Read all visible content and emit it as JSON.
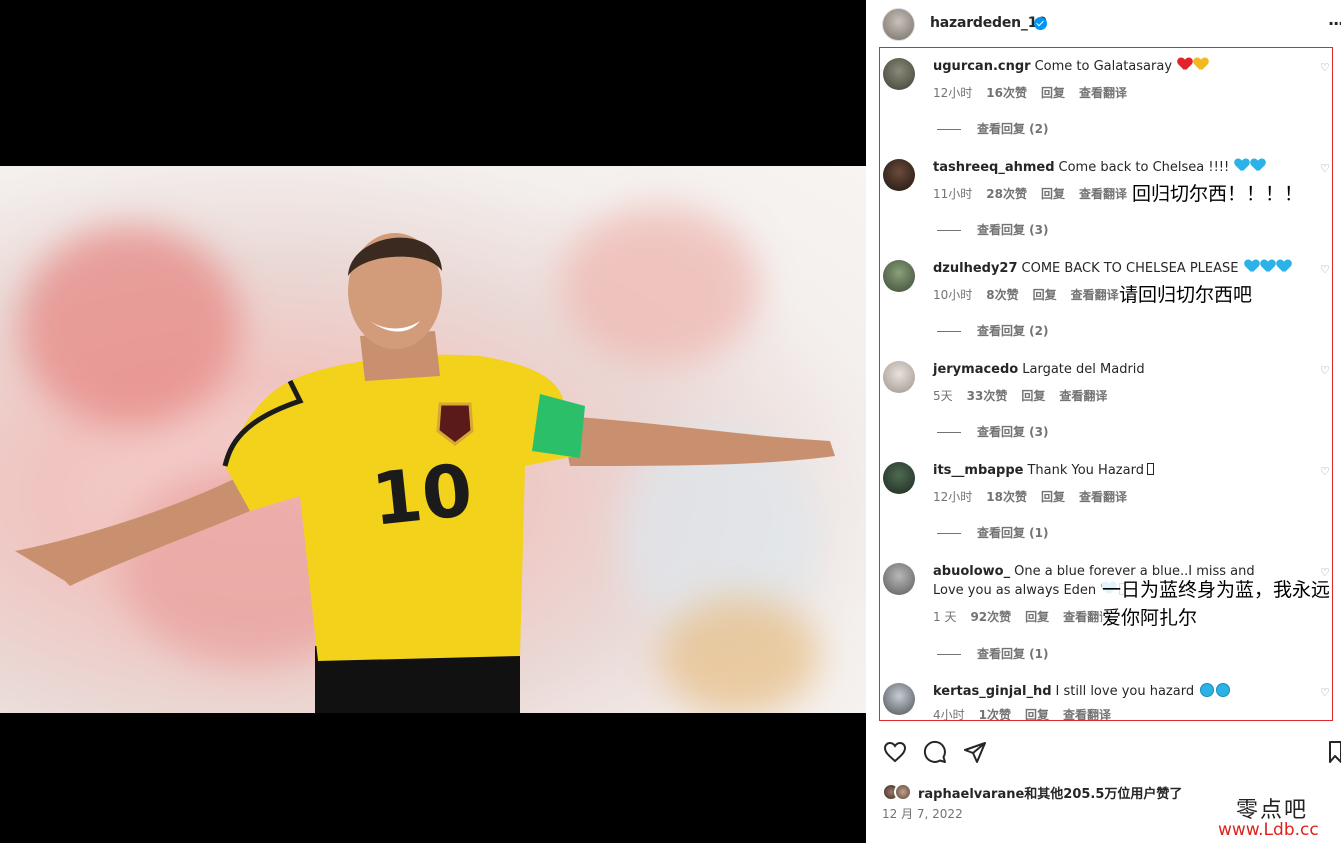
{
  "post": {
    "username": "hazardeden_10",
    "photo_alt": "Eden Hazard celebrating in Belgium yellow jersey number 10"
  },
  "comments": [
    {
      "user": "ugurcan.cngr",
      "text": "Come to Galatasaray",
      "emoji": [
        "red-heart",
        "yellow-heart"
      ],
      "time": "12小时",
      "likes": "16次赞",
      "reply": "回复",
      "translate": "查看翻译",
      "view_replies": "查看回复 (2)"
    },
    {
      "user": "tashreeq_ahmed",
      "text": "Come back to Chelsea !!!!",
      "emoji": [
        "blue-heart",
        "blue-heart"
      ],
      "time": "11小时",
      "likes": "28次赞",
      "reply": "回复",
      "translate": "查看翻译",
      "view_replies": "查看回复 (3)",
      "annotation": "回归切尔西！！！！"
    },
    {
      "user": "dzulhedy27",
      "text": "COME BACK TO CHELSEA PLEASE",
      "emoji": [
        "blue-heart",
        "blue-heart",
        "blue-heart"
      ],
      "time": "10小时",
      "likes": "8次赞",
      "reply": "回复",
      "translate": "查看翻译",
      "view_replies": "查看回复 (2)",
      "annotation": "请回归切尔西吧"
    },
    {
      "user": "jerymacedo",
      "text": "Largate del Madrid",
      "emoji": [],
      "time": "5天",
      "likes": "33次赞",
      "reply": "回复",
      "translate": "查看翻译",
      "view_replies": "查看回复 (3)"
    },
    {
      "user": "its__mbappe",
      "text": "Thank You Hazard",
      "emoji": [
        "tofu"
      ],
      "time": "12小时",
      "likes": "18次赞",
      "reply": "回复",
      "translate": "查看翻译",
      "view_replies": "查看回复 (1)"
    },
    {
      "user": "abuolowo_",
      "text": "One a blue forever a blue..I miss and Love you as always Eden",
      "emoji": [
        "blue-heart",
        "tofu"
      ],
      "time": "1 天",
      "likes": "92次赞",
      "reply": "回复",
      "translate": "查看翻译",
      "view_replies": "查看回复 (1)",
      "annotation": "一日为蓝终身为蓝，我永远爱你阿扎尔"
    },
    {
      "user": "kertas_ginjal_hd",
      "text": "I still love you hazard",
      "emoji": [
        "blue-circle",
        "blue-circle"
      ],
      "time": "4小时",
      "likes": "1次赞",
      "reply": "回复",
      "translate": "查看翻译"
    }
  ],
  "footer": {
    "likes_text": "raphaelvarane和其他205.5万位用户赞了",
    "date": "12 月 7, 2022"
  },
  "icons": [
    "heart-icon",
    "comment-icon",
    "share-icon",
    "bookmark-icon",
    "verified-icon",
    "more-icon"
  ],
  "watermark": {
    "line1": "零点吧",
    "line2": "www.Ldb.cc"
  },
  "colors": {
    "highlight_box": "#e0292b",
    "verified": "#0095f6",
    "meta": "#737373",
    "watermark_red": "#e0211b"
  }
}
